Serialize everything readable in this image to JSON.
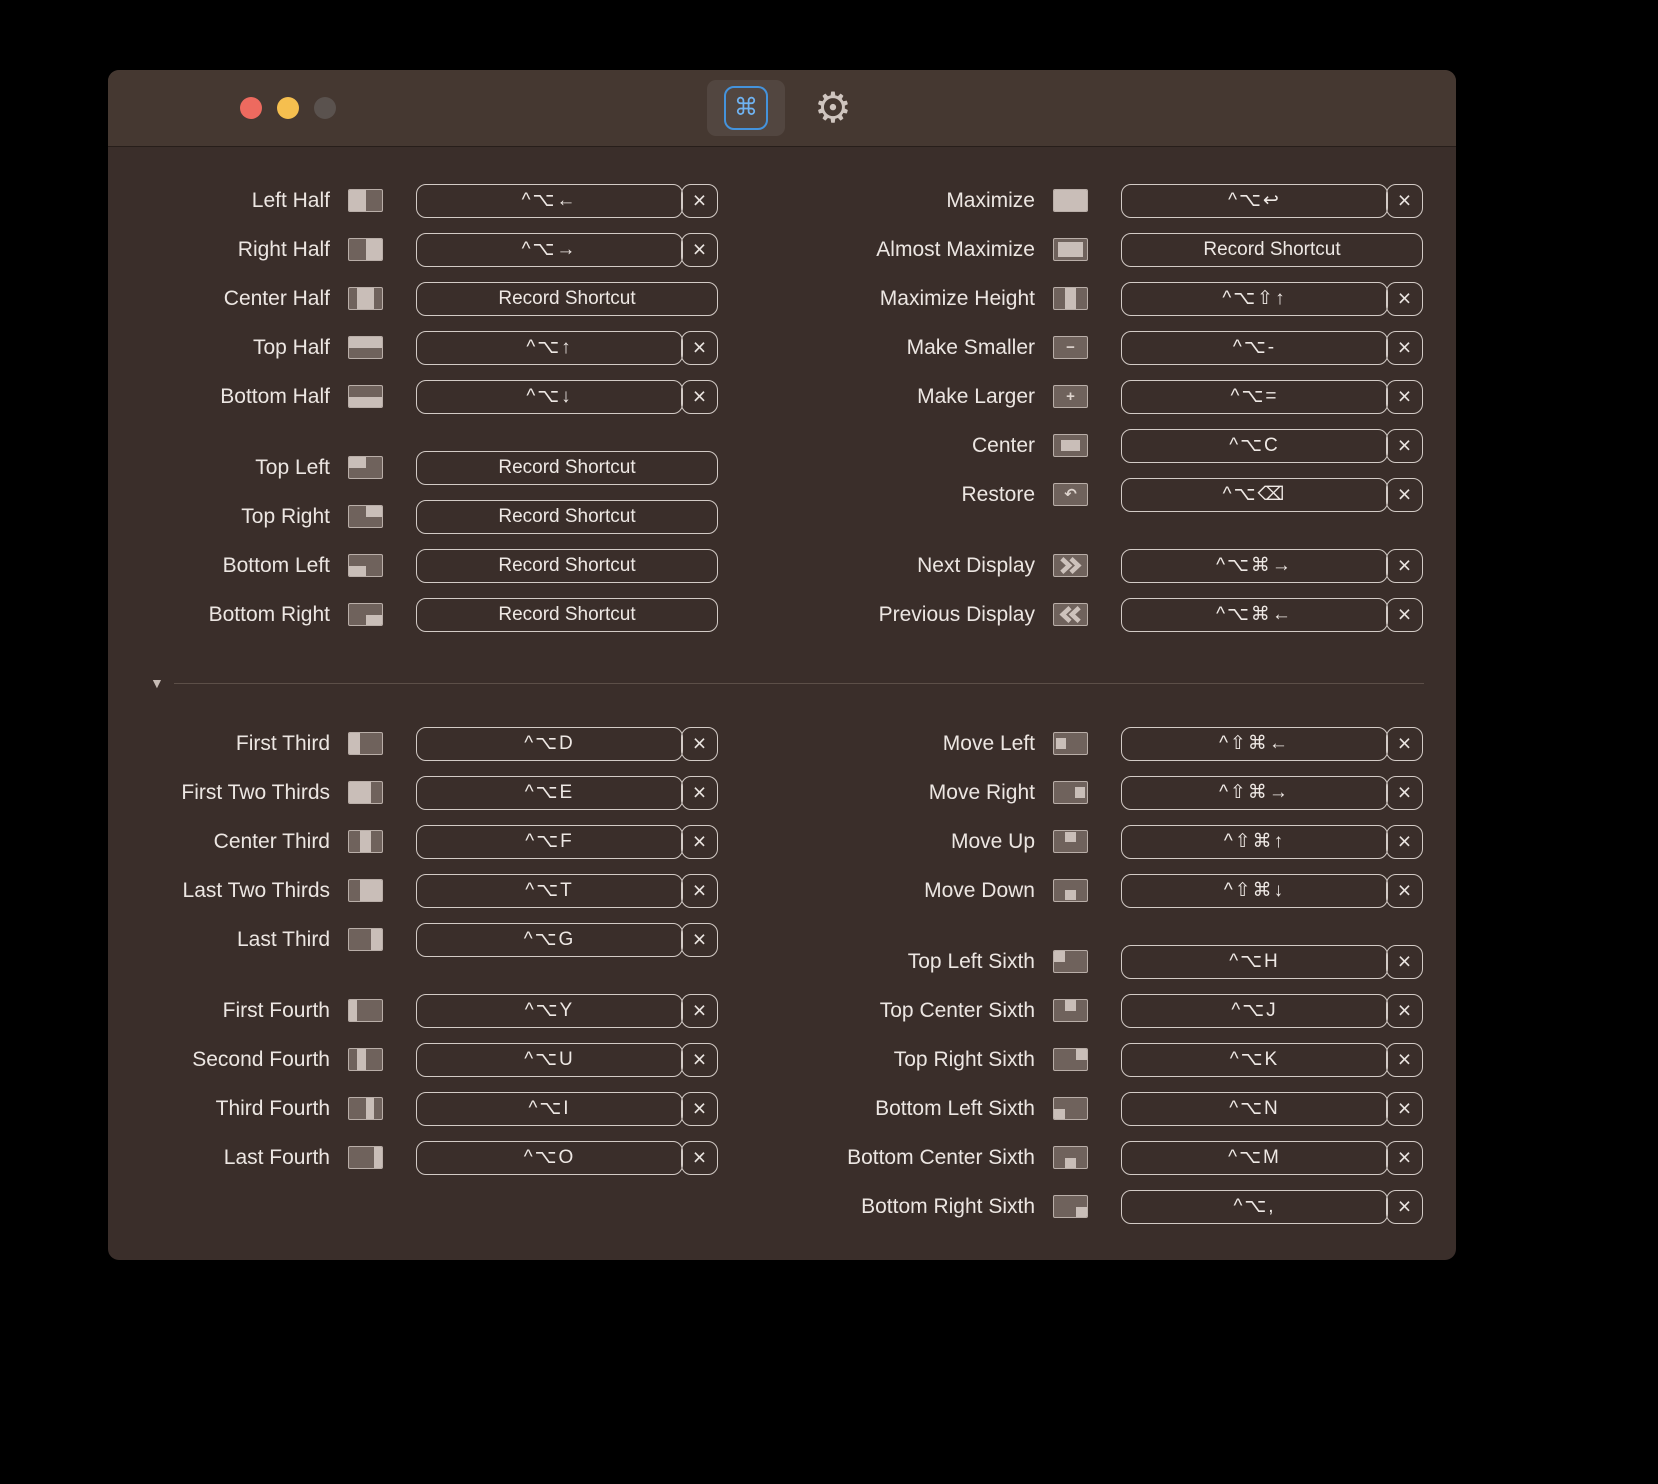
{
  "ui": {
    "clear_glyph": "×",
    "record_label": "Record Shortcut",
    "disclosure_glyph": "▼"
  },
  "toolbar": {
    "items": [
      {
        "name": "shortcuts-tab",
        "icon": "command-icon",
        "glyph": "⌘",
        "selected": true
      },
      {
        "name": "settings-tab",
        "icon": "gear-icon",
        "glyph": "⚙",
        "selected": false
      }
    ]
  },
  "colors": {
    "window_bg": "#3a2e2a",
    "titlebar_bg": "#453831",
    "focus_blue": "#4493dc",
    "button_border": "#d3cbc6",
    "traffic_close": "#ed6a5f",
    "traffic_minimize": "#f5bf4f",
    "traffic_zoom_disabled": "#5a524e"
  },
  "sections": {
    "top_left": {
      "groups": [
        [
          {
            "label": "Left Half",
            "icon": "left-half",
            "shortcut": "^⌥←",
            "clearable": true
          },
          {
            "label": "Right Half",
            "icon": "right-half",
            "shortcut": "^⌥→",
            "clearable": true
          },
          {
            "label": "Center Half",
            "icon": "center-half",
            "shortcut": "Record Shortcut",
            "clearable": false
          },
          {
            "label": "Top Half",
            "icon": "top-half",
            "shortcut": "^⌥↑",
            "clearable": true
          },
          {
            "label": "Bottom Half",
            "icon": "bottom-half",
            "shortcut": "^⌥↓",
            "clearable": true
          }
        ],
        [
          {
            "label": "Top Left",
            "icon": "top-left",
            "shortcut": "Record Shortcut",
            "clearable": false
          },
          {
            "label": "Top Right",
            "icon": "top-right",
            "shortcut": "Record Shortcut",
            "clearable": false
          },
          {
            "label": "Bottom Left",
            "icon": "bottom-left",
            "shortcut": "Record Shortcut",
            "clearable": false
          },
          {
            "label": "Bottom Right",
            "icon": "bottom-right",
            "shortcut": "Record Shortcut",
            "clearable": false
          }
        ]
      ]
    },
    "top_right": {
      "groups": [
        [
          {
            "label": "Maximize",
            "icon": "maximize",
            "shortcut": "^⌥↩",
            "clearable": true
          },
          {
            "label": "Almost Maximize",
            "icon": "almost-maximize",
            "shortcut": "Record Shortcut",
            "clearable": false
          },
          {
            "label": "Maximize Height",
            "icon": "maximize-height",
            "shortcut": "^⌥⇧↑",
            "clearable": true
          },
          {
            "label": "Make Smaller",
            "icon": "make-smaller",
            "shortcut": "^⌥-",
            "clearable": true
          },
          {
            "label": "Make Larger",
            "icon": "make-larger",
            "shortcut": "^⌥=",
            "clearable": true
          },
          {
            "label": "Center",
            "icon": "center",
            "shortcut": "^⌥C",
            "clearable": true
          },
          {
            "label": "Restore",
            "icon": "restore",
            "shortcut": "^⌥⌫",
            "clearable": true
          }
        ],
        [
          {
            "label": "Next Display",
            "icon": "next-display",
            "shortcut": "^⌥⌘→",
            "clearable": true
          },
          {
            "label": "Previous Display",
            "icon": "previous-display",
            "shortcut": "^⌥⌘←",
            "clearable": true
          }
        ]
      ]
    },
    "bottom_left": {
      "groups": [
        [
          {
            "label": "First Third",
            "icon": "first-third",
            "shortcut": "^⌥D",
            "clearable": true
          },
          {
            "label": "First Two Thirds",
            "icon": "first-two-thirds",
            "shortcut": "^⌥E",
            "clearable": true
          },
          {
            "label": "Center Third",
            "icon": "center-third",
            "shortcut": "^⌥F",
            "clearable": true
          },
          {
            "label": "Last Two Thirds",
            "icon": "last-two-thirds",
            "shortcut": "^⌥T",
            "clearable": true
          },
          {
            "label": "Last Third",
            "icon": "last-third",
            "shortcut": "^⌥G",
            "clearable": true
          }
        ],
        [
          {
            "label": "First Fourth",
            "icon": "first-fourth",
            "shortcut": "^⌥Y",
            "clearable": true
          },
          {
            "label": "Second Fourth",
            "icon": "second-fourth",
            "shortcut": "^⌥U",
            "clearable": true
          },
          {
            "label": "Third Fourth",
            "icon": "third-fourth",
            "shortcut": "^⌥I",
            "clearable": true
          },
          {
            "label": "Last Fourth",
            "icon": "last-fourth",
            "shortcut": "^⌥O",
            "clearable": true
          }
        ]
      ]
    },
    "bottom_right": {
      "groups": [
        [
          {
            "label": "Move Left",
            "icon": "move-left",
            "shortcut": "^⇧⌘←",
            "clearable": true
          },
          {
            "label": "Move Right",
            "icon": "move-right",
            "shortcut": "^⇧⌘→",
            "clearable": true
          },
          {
            "label": "Move Up",
            "icon": "move-up",
            "shortcut": "^⇧⌘↑",
            "clearable": true
          },
          {
            "label": "Move Down",
            "icon": "move-down",
            "shortcut": "^⇧⌘↓",
            "clearable": true
          }
        ],
        [
          {
            "label": "Top Left Sixth",
            "icon": "top-left-sixth",
            "shortcut": "^⌥H",
            "clearable": true
          },
          {
            "label": "Top Center Sixth",
            "icon": "top-center-sixth",
            "shortcut": "^⌥J",
            "clearable": true
          },
          {
            "label": "Top Right Sixth",
            "icon": "top-right-sixth",
            "shortcut": "^⌥K",
            "clearable": true
          },
          {
            "label": "Bottom Left Sixth",
            "icon": "bottom-left-sixth",
            "shortcut": "^⌥N",
            "clearable": true
          },
          {
            "label": "Bottom Center Sixth",
            "icon": "bottom-center-sixth",
            "shortcut": "^⌥M",
            "clearable": true
          },
          {
            "label": "Bottom Right Sixth",
            "icon": "bottom-right-sixth",
            "shortcut": "^⌥,",
            "clearable": true
          }
        ]
      ]
    }
  }
}
